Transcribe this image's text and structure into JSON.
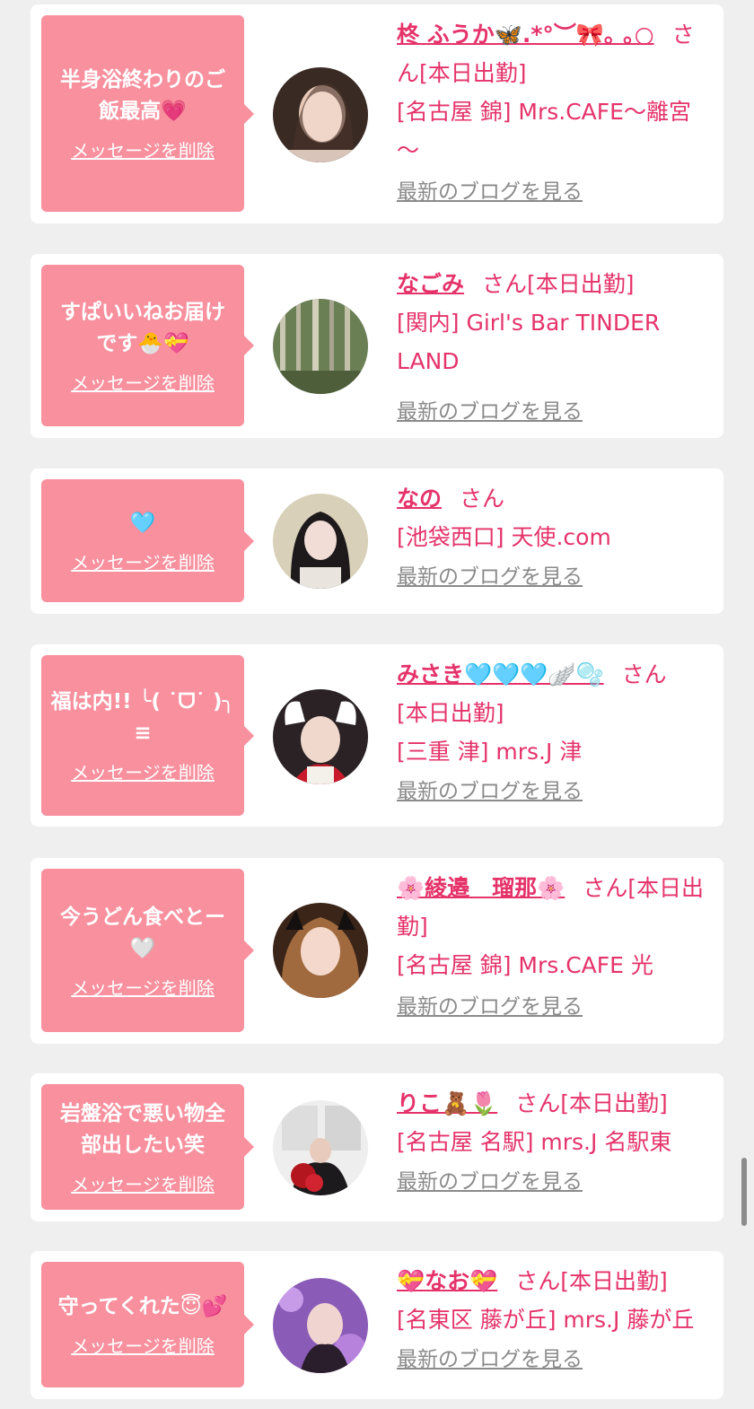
{
  "delete_label": "メッセージを削除",
  "blog_label": "最新のブログを見る",
  "honorific": "さん",
  "colors": {
    "page_bg": "#efefef",
    "card_bg": "#ffffff",
    "bubble_bg": "#f8909e",
    "accent_text": "#e5336a",
    "link_gray": "#8a8a8a"
  },
  "messages": [
    {
      "bubble_text": "半身浴終わりのご飯最高💗",
      "name": "柊 ふうか🦋.*°︶🎀｡ ｡○",
      "status": "[本日出勤]",
      "shop": "[名古屋 錦] Mrs.CAFE～離宮～"
    },
    {
      "bubble_text": "すぱいいねお届けです🐣💝",
      "name": "なごみ",
      "status": "[本日出勤]",
      "shop": "[関内] Girl's Bar TINDER LAND"
    },
    {
      "bubble_text": "🩵",
      "name": "なの",
      "status": "",
      "shop": "[池袋西口] 天使.com"
    },
    {
      "bubble_text": "福は内!! ╰( ˙ᗜ˙ )╮ ≡",
      "name": "みさき🩵🩵🩵🪽🫧",
      "status": "[本日出勤]",
      "shop": "[三重 津] mrs.J 津"
    },
    {
      "bubble_text": "今うどん食べとー🤍",
      "name": "🌸綾邉　瑠那🌸",
      "status": "[本日出勤]",
      "shop": "[名古屋 錦] Mrs.CAFE 光"
    },
    {
      "bubble_text": "岩盤浴で悪い物全部出したい笑",
      "name": "りこ🧸🌷",
      "status": "[本日出勤]",
      "shop": "[名古屋 名駅] mrs.J 名駅東"
    },
    {
      "bubble_text": "守ってくれた😇💕",
      "name": "💝なお💝",
      "status": "[本日出勤]",
      "shop": "[名東区 藤が丘] mrs.J 藤が丘"
    }
  ]
}
